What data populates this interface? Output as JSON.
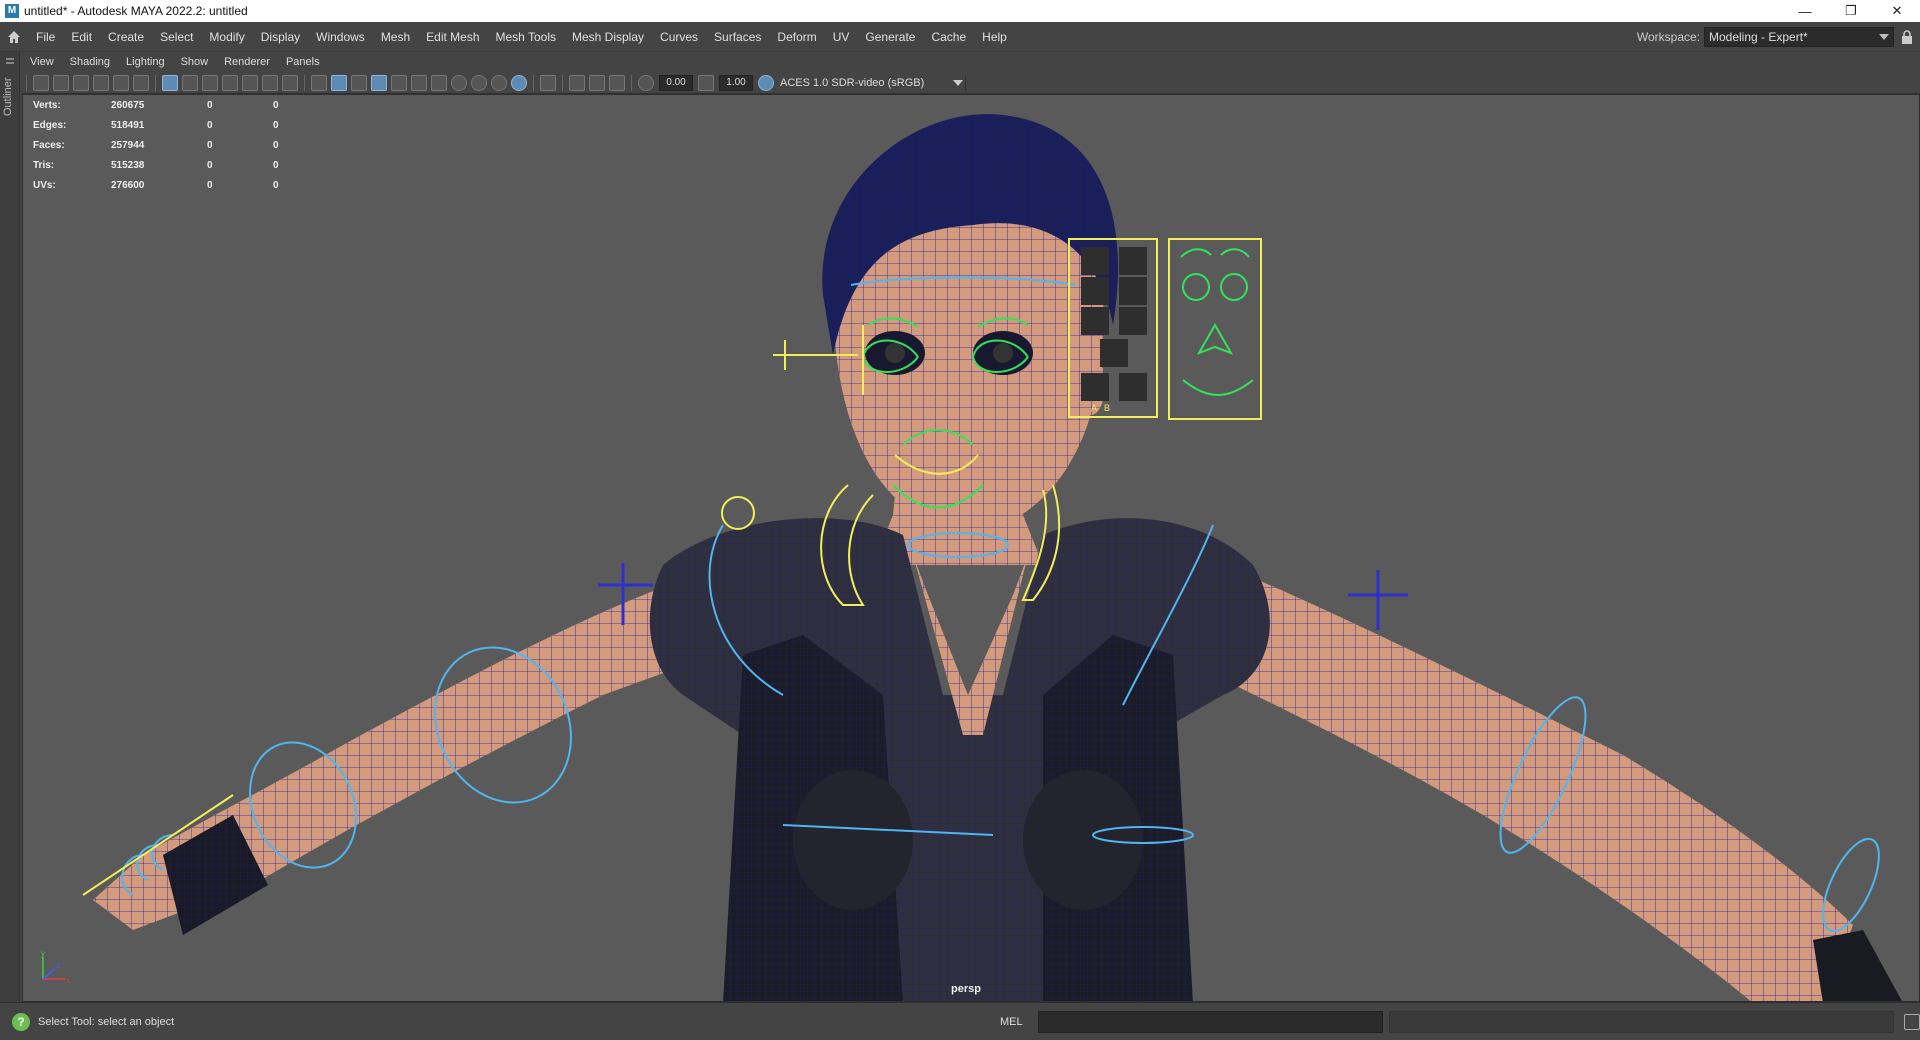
{
  "window": {
    "icon_letter": "M",
    "title": "untitled* - Autodesk MAYA 2022.2: untitled",
    "minimize": "—",
    "restore": "❐",
    "close": "✕"
  },
  "menubar": {
    "items": [
      "File",
      "Edit",
      "Create",
      "Select",
      "Modify",
      "Display",
      "Windows",
      "Mesh",
      "Edit Mesh",
      "Mesh Tools",
      "Mesh Display",
      "Curves",
      "Surfaces",
      "Deform",
      "UV",
      "Generate",
      "Cache",
      "Help"
    ],
    "workspace_label": "Workspace:",
    "workspace_value": "Modeling - Expert*"
  },
  "outliner": {
    "label": "Outliner"
  },
  "panel_menu": {
    "items": [
      "View",
      "Shading",
      "Lighting",
      "Show",
      "Renderer",
      "Panels"
    ]
  },
  "panel_toolbar": {
    "exposure": "0.00",
    "gamma": "1.00",
    "color_space": "ACES 1.0 SDR-video (sRGB)"
  },
  "hud": {
    "rows": [
      {
        "label": "Verts:",
        "value": "260675",
        "sel": "0",
        "comp": "0"
      },
      {
        "label": "Edges:",
        "value": "518491",
        "sel": "0",
        "comp": "0"
      },
      {
        "label": "Faces:",
        "value": "257944",
        "sel": "0",
        "comp": "0"
      },
      {
        "label": "Tris:",
        "value": "515238",
        "sel": "0",
        "comp": "0"
      },
      {
        "label": "UVs:",
        "value": "276600",
        "sel": "0",
        "comp": "0"
      }
    ]
  },
  "viewport": {
    "camera": "persp",
    "axis_x": "x",
    "axis_y": "y",
    "axis_z": "z",
    "facial_button_a": "A",
    "facial_button_b": "B"
  },
  "statusbar": {
    "help_text": "Select Tool: select an object",
    "command_lang": "MEL"
  },
  "colors": {
    "skin": "#d49a7c",
    "wire": "#1a1aa8",
    "vest": "#222230",
    "hair": "#1a1f55",
    "ctrl_blue": "#4fb6f0",
    "ctrl_yellow": "#f2ee5a",
    "ctrl_green": "#32e35a"
  }
}
